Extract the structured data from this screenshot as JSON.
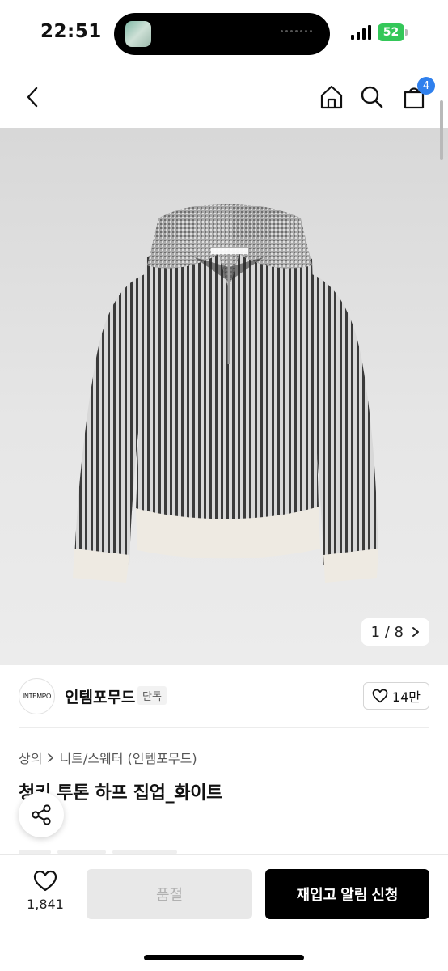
{
  "status_bar": {
    "time": "22:51",
    "battery_level": "52"
  },
  "header": {
    "cart_count": "4"
  },
  "product_image": {
    "counter": "1 / 8"
  },
  "brand": {
    "logo_text": "INTEMPO",
    "name": "인템포무드",
    "tag": "단독",
    "like_count": "14만"
  },
  "breadcrumb": {
    "category": "상의",
    "subcategory": "니트/스웨터 (인템포무드)"
  },
  "product": {
    "title": "청키 투톤 하프 집업_화이트"
  },
  "bottom_bar": {
    "wish_count": "1,841",
    "soldout_label": "품절",
    "restock_label": "재입고 알림 신청"
  },
  "colors": {
    "accent": "#2f80ed",
    "battery": "#34c759"
  }
}
